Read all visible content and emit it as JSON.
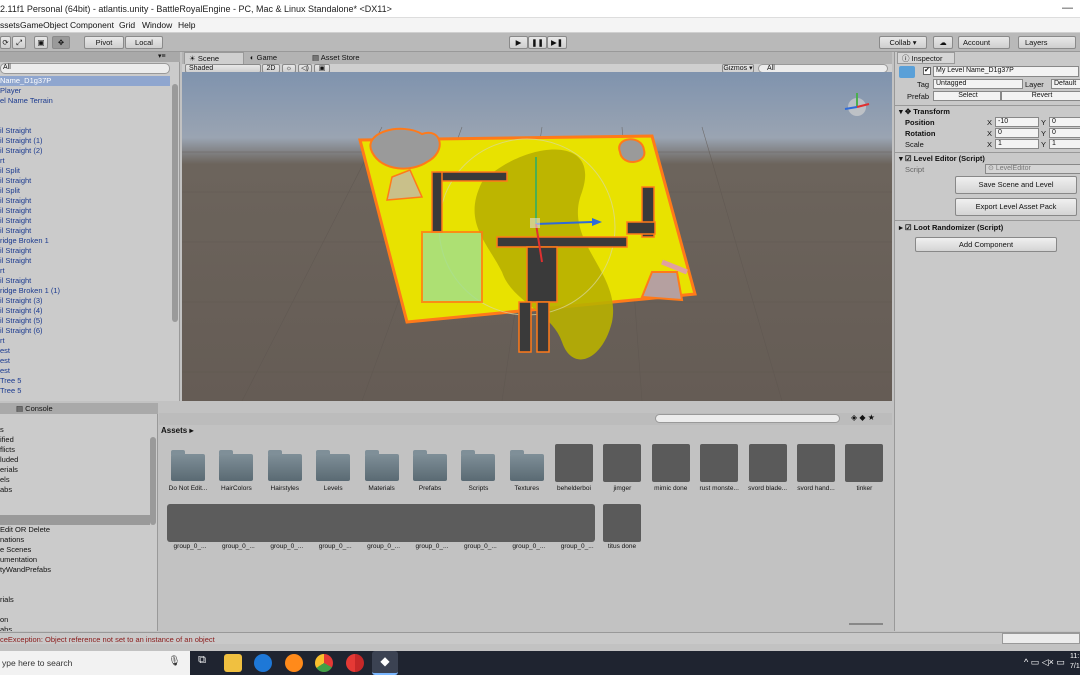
{
  "window": {
    "title": "2.11f1 Personal (64bit) - atlantis.unity - BattleRoyalEngine - PC, Mac & Linux Standalone* <DX11>"
  },
  "menu": [
    "ssets",
    "GameObject",
    "Component",
    "Grid",
    "Window",
    "Help"
  ],
  "toolbar": {
    "pivot": "Pivot",
    "local": "Local",
    "collab": "Collab ▾",
    "account": "Account",
    "layers": "Layers"
  },
  "scene_tabs": {
    "scene": "Scene",
    "game": "Game",
    "asset_store": "Asset Store",
    "shaded": "Shaded",
    "two_d": "2D",
    "gizmos": "Gizmos ▾",
    "search_placeholder": "All"
  },
  "hierarchy": {
    "search": "All",
    "items": [
      "Name_D1g37P",
      "Player",
      "el Name Terrain",
      "",
      "",
      "il Straight",
      "il Straight (1)",
      "il Straight (2)",
      "rt",
      "il Split",
      "il Straight",
      "il Split",
      "il Straight",
      "il Straight",
      "il Straight",
      "il Straight",
      "ridge Broken 1",
      "il Straight",
      "il Straight",
      "rt",
      "il Straight",
      "ridge Broken 1 (1)",
      "il Straight (3)",
      "il Straight (4)",
      "il Straight (5)",
      "il Straight (6)",
      "rt",
      "est",
      "est",
      "est",
      "Tree 5",
      "Tree 5"
    ]
  },
  "bottom_tabs": {
    "console": "Console"
  },
  "project": {
    "items": [
      "s",
      "ified",
      "flicts",
      "luded",
      "erials",
      "els",
      "abs",
      "",
      "",
      "",
      "Edit OR Delete",
      "nations",
      "e Scenes",
      "umentation",
      "tyWandPrefabs",
      "",
      "",
      "rials",
      "",
      "on",
      "abs",
      "sources"
    ]
  },
  "assets": {
    "breadcrumb": "Assets",
    "folders": [
      "Do Not Edit...",
      "HairColors",
      "Hairstyles",
      "Levels",
      "Materials",
      "Prefabs",
      "Scripts",
      "Textures"
    ],
    "models": [
      "behelderboi",
      "jimger",
      "mimic done",
      "rust monste...",
      "svord blade...",
      "svord hand...",
      "tinker"
    ],
    "group_items": [
      "group_0_...",
      "group_0_...",
      "group_0_...",
      "group_0_...",
      "group_0_...",
      "group_0_...",
      "group_0_...",
      "group_0_...",
      "group_0_..."
    ],
    "last": "titus done"
  },
  "status": {
    "error": "ceException: Object reference not set to an instance of an object"
  },
  "inspector": {
    "tab": "Inspector",
    "object_name": "My Level Name_D1g37P",
    "tag_label": "Tag",
    "tag_value": "Untagged",
    "layer_label": "Layer",
    "layer_value": "Default",
    "prefab_label": "Prefab",
    "select": "Select",
    "revert": "Revert",
    "transform": "Transform",
    "position": "Position",
    "rotation": "Rotation",
    "scale": "Scale",
    "pos_x": "-10",
    "pos_y": "0",
    "rot_x": "0",
    "rot_y": "0",
    "scale_x": "1",
    "scale_y": "1",
    "x": "X",
    "y": "Y",
    "level_editor": "Level Editor (Script)",
    "script_label": "Script",
    "script_value": "LevelEditor",
    "save_btn": "Save Scene and Level",
    "export_btn": "Export Level Asset Pack",
    "loot": "Loot Randomizer (Script)",
    "add_component": "Add Component"
  },
  "taskbar": {
    "search": "ype here to search",
    "time": "11:",
    "date": "7/1"
  },
  "colors": {
    "terrain": "#e8e200",
    "accent": "#ff7a1a",
    "panel": "#c2c2c2"
  }
}
